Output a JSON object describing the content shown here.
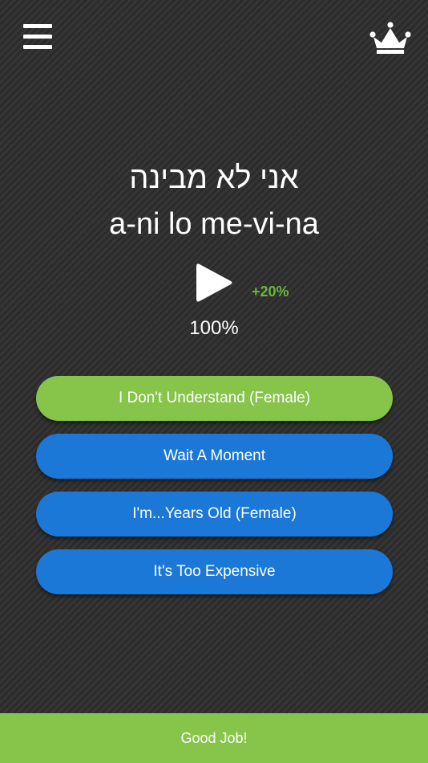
{
  "header": {
    "menu_icon": "hamburger-menu-icon",
    "premium_icon": "crown-icon"
  },
  "phrase": {
    "native": "אני לא מבינה",
    "transliteration": "a-ni lo me-vi-na"
  },
  "audio": {
    "play_icon": "play-icon",
    "bonus": "+20%",
    "progress": "100%",
    "progress_value": 100
  },
  "options": [
    {
      "label": "I Don't Understand (Female)",
      "state": "correct"
    },
    {
      "label": "Wait A Moment",
      "state": "default"
    },
    {
      "label": "I'm...Years Old (Female)",
      "state": "default"
    },
    {
      "label": "It's Too Expensive",
      "state": "default"
    }
  ],
  "feedback": {
    "label": "Good Job!"
  },
  "colors": {
    "correct": "#86c54a",
    "option": "#1b78d6",
    "bonus": "#6cb43f",
    "background": "#2e2e2e"
  }
}
